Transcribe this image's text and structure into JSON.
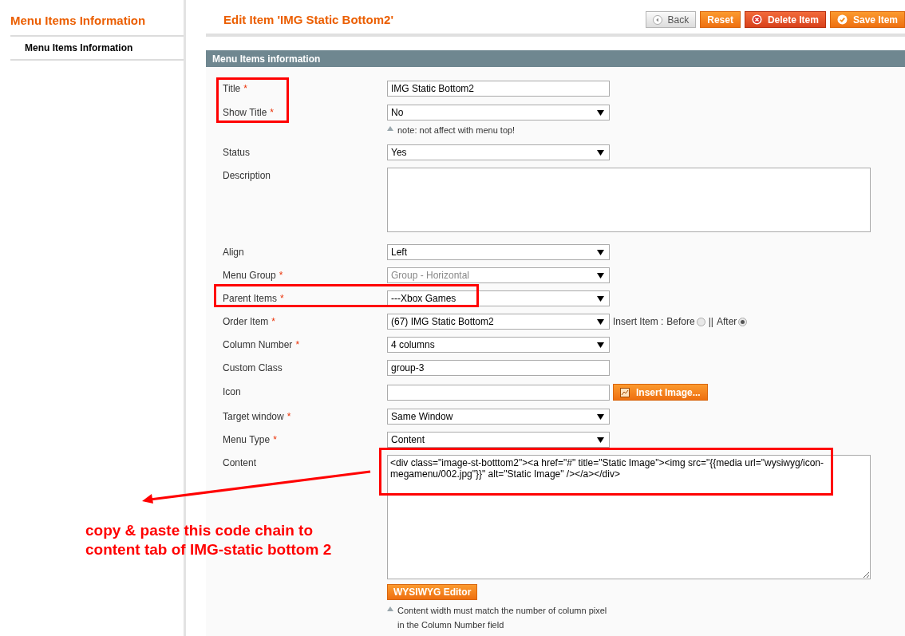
{
  "sidebar": {
    "title": "Menu Items Information",
    "items": [
      {
        "label": "Menu Items Information",
        "selected": true
      }
    ]
  },
  "header": {
    "title": "Edit Item 'IMG Static Bottom2'",
    "buttons": [
      {
        "label": "Back",
        "kind": "back"
      },
      {
        "label": "Reset",
        "kind": "reset"
      },
      {
        "label": "Delete Item",
        "kind": "delete"
      },
      {
        "label": "Save Item",
        "kind": "save"
      }
    ]
  },
  "required_mark": "*",
  "section": {
    "title": "Menu Items information",
    "fields": [
      {
        "label": "Title",
        "required": true,
        "kind": "text",
        "value": "IMG Static Bottom2",
        "disabled": false
      },
      {
        "label": "Show Title",
        "required": true,
        "kind": "select",
        "value": "No",
        "disabled": false,
        "note": "note: not affect with menu top!"
      },
      {
        "label": "Status",
        "required": false,
        "kind": "select",
        "value": "Yes",
        "disabled": false
      },
      {
        "label": "Description",
        "required": false,
        "kind": "textarea",
        "disabled": false
      },
      {
        "label": "Align",
        "required": false,
        "kind": "select",
        "value": "Left",
        "disabled": false
      },
      {
        "label": "Menu Group",
        "required": true,
        "kind": "select",
        "value": "Group - Horizontal",
        "disabled": true
      },
      {
        "label": "Parent Items",
        "required": true,
        "kind": "select",
        "value": "---Xbox Games",
        "disabled": false
      },
      {
        "label": "Order Item",
        "required": true,
        "kind": "select",
        "value": "(67) IMG Static Bottom2",
        "disabled": false,
        "insert_position": {
          "label": "Insert Item :",
          "separator": "||",
          "options": [
            {
              "label": "Before",
              "selected": false
            },
            {
              "label": "After",
              "selected": true
            }
          ]
        }
      },
      {
        "label": "Column Number",
        "required": true,
        "kind": "select",
        "value": "4 columns",
        "disabled": false
      },
      {
        "label": "Custom Class",
        "required": false,
        "kind": "text",
        "value": "group-3",
        "disabled": false
      },
      {
        "label": "Icon",
        "required": false,
        "kind": "image",
        "disabled": false,
        "button": "Insert Image..."
      },
      {
        "label": "Target window",
        "required": true,
        "kind": "select",
        "value": "Same Window",
        "disabled": false
      },
      {
        "label": "Menu Type",
        "required": true,
        "kind": "select",
        "value": "Content",
        "disabled": false
      },
      {
        "label": "Content",
        "required": false,
        "kind": "editor",
        "disabled": false,
        "value": "<div class=\"image-st-botttom2\"><a href=\"#\" title=\"Static Image\"><img src=\"{{media url=\"wysiwyg/icon-megamenu/002.jpg\"}}\" alt=\"Static Image\" /></a></div>",
        "button": "WYSIWYG Editor",
        "notes": [
          "Content width must match the number of column pixel",
          "in the Column Number field"
        ]
      }
    ]
  },
  "annotation": {
    "lines": [
      "copy & paste this code chain to",
      "content tab of IMG-static bottom 2"
    ]
  }
}
